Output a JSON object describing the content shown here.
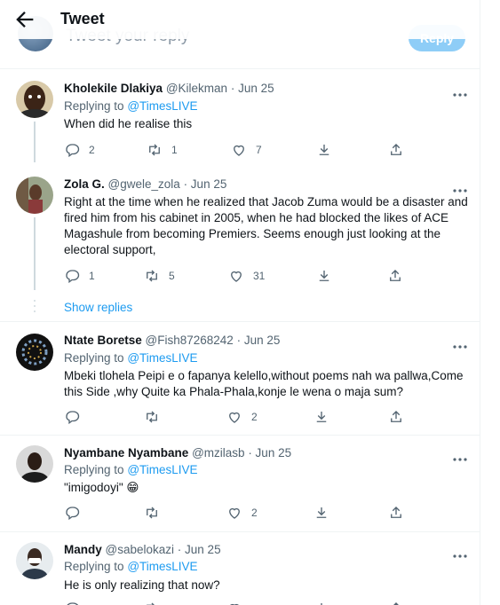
{
  "header": {
    "title": "Tweet"
  },
  "compose": {
    "placeholder": "Tweet your reply",
    "reply_button": "Reply"
  },
  "tweets": [
    {
      "name": "Kholekile Dlakiya",
      "handle": "@Kilekman",
      "date": "· Jun 25",
      "replying_label": "Replying to",
      "replying_to": "@TimesLIVE",
      "text": "When did he realise this",
      "counts": {
        "replies": "2",
        "retweets": "1",
        "likes": "7"
      }
    },
    {
      "name": "Zola G.",
      "handle": "@gwele_zola",
      "date": "· Jun 25",
      "text": "Right at the time when he realized that Jacob Zuma would be a disaster and fired him from his cabinet in 2005, when he had blocked the likes of ACE Magashule from becoming Premiers. Seems enough just looking at the electoral support,",
      "counts": {
        "replies": "1",
        "retweets": "5",
        "likes": "31"
      },
      "show_replies": "Show replies"
    },
    {
      "name": "Ntate Boretse",
      "handle": "@Fish87268242",
      "date": "· Jun 25",
      "replying_label": "Replying to",
      "replying_to": "@TimesLIVE",
      "text": "Mbeki tlohela Peipi e o fapanya kelello,without poems nah wa pallwa,Come this Side ,why Quite ka Phala-Phala,konje le wena o maja sum?",
      "counts": {
        "replies": "",
        "retweets": "",
        "likes": "2"
      }
    },
    {
      "name": "Nyambane Nyambane",
      "handle": "@mzilasb",
      "date": "· Jun 25",
      "replying_label": "Replying to",
      "replying_to": "@TimesLIVE",
      "text": "\"imigodoyi\" 😁",
      "counts": {
        "replies": "",
        "retweets": "",
        "likes": "2"
      }
    },
    {
      "name": "Mandy",
      "handle": "@sabelokazi",
      "date": "· Jun 25",
      "replying_label": "Replying to",
      "replying_to": "@TimesLIVE",
      "text": "He is only realizing that now?",
      "counts": {
        "replies": "",
        "retweets": "",
        "likes": ""
      }
    }
  ],
  "colors": {
    "accent": "#1d9bf0",
    "muted": "#536471",
    "border": "#eff3f4"
  },
  "icons": [
    "back-arrow-icon",
    "more-icon",
    "reply-icon",
    "retweet-icon",
    "like-icon",
    "share-icon",
    "upload-icon"
  ]
}
